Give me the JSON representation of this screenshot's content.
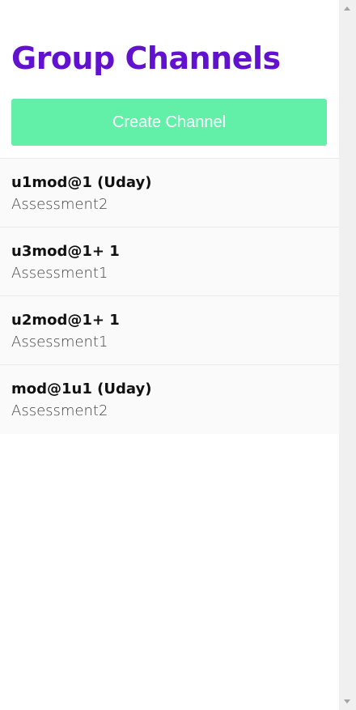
{
  "header": {
    "title": "Group Channels"
  },
  "actions": {
    "create_label": "Create Channel"
  },
  "channels": [
    {
      "name": "u1mod@1 (Uday)",
      "subtitle": "Assessment2"
    },
    {
      "name": "u3mod@1+ 1",
      "subtitle": "Assessment1"
    },
    {
      "name": "u2mod@1+ 1",
      "subtitle": "Assessment1"
    },
    {
      "name": "mod@1u1 (Uday)",
      "subtitle": "Assessment2"
    }
  ],
  "colors": {
    "title": "#6212cf",
    "button_bg": "#62f0a9",
    "button_text": "#ffffff",
    "list_bg": "#fafafa"
  },
  "icons": {
    "scroll_up": "arrow-up-icon",
    "scroll_down": "arrow-down-icon"
  }
}
